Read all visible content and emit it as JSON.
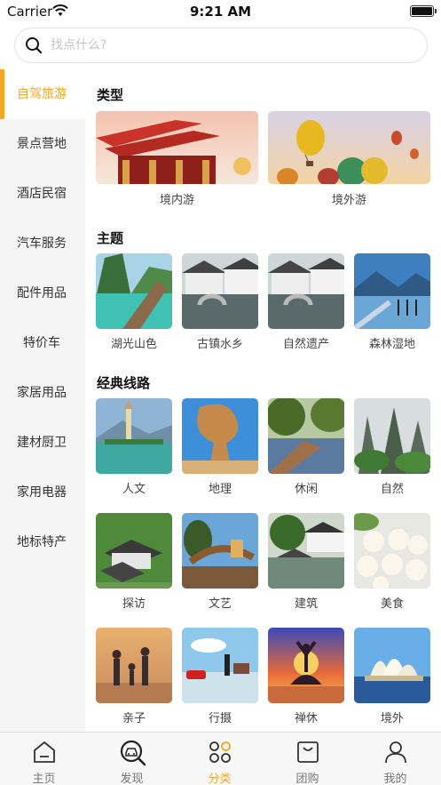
{
  "status_bar": {
    "carrier": "Carrier",
    "time": "9:21 AM"
  },
  "search": {
    "placeholder": "找点什么?"
  },
  "sidebar": {
    "items": [
      {
        "label": "自驾旅游",
        "active": true
      },
      {
        "label": "景点营地"
      },
      {
        "label": "酒店民宿"
      },
      {
        "label": "汽车服务"
      },
      {
        "label": "配件用品"
      },
      {
        "label": "特价车"
      },
      {
        "label": "家居用品"
      },
      {
        "label": "建材厨卫"
      },
      {
        "label": "家用电器"
      },
      {
        "label": "地标特产"
      }
    ]
  },
  "sections": [
    {
      "title": "类型",
      "items": [
        {
          "label": "境内游"
        },
        {
          "label": "境外游"
        }
      ]
    },
    {
      "title": "主题",
      "items": [
        {
          "label": "湖光山色"
        },
        {
          "label": "古镇水乡"
        },
        {
          "label": "自然遗产"
        },
        {
          "label": "森林湿地"
        }
      ]
    },
    {
      "title": "经典线路",
      "items": [
        {
          "label": "人文"
        },
        {
          "label": "地理"
        },
        {
          "label": "休闲"
        },
        {
          "label": "自然"
        },
        {
          "label": "探访"
        },
        {
          "label": "文艺"
        },
        {
          "label": "建筑"
        },
        {
          "label": "美食"
        },
        {
          "label": "亲子"
        },
        {
          "label": "行摄"
        },
        {
          "label": "禅休"
        },
        {
          "label": "境外"
        }
      ]
    }
  ],
  "tabbar": {
    "items": [
      {
        "label": "主页",
        "icon": "home-icon"
      },
      {
        "label": "发现",
        "icon": "discover-icon"
      },
      {
        "label": "分类",
        "icon": "category-icon",
        "active": true
      },
      {
        "label": "团购",
        "icon": "group-buy-icon"
      },
      {
        "label": "我的",
        "icon": "profile-icon"
      }
    ]
  },
  "colors": {
    "accent": "#f5a623",
    "sidebar_bg": "#f5f5f5"
  }
}
